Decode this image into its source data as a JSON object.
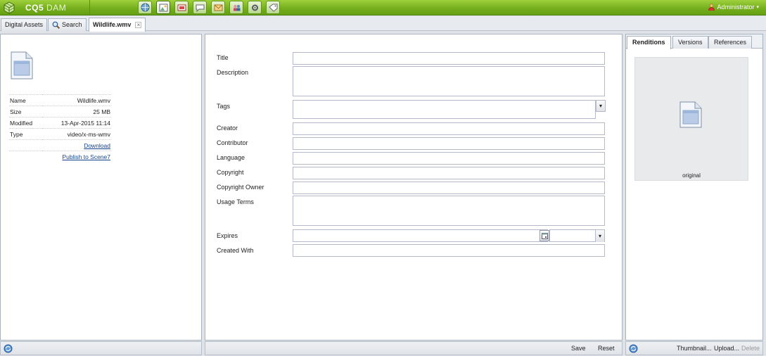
{
  "topbar": {
    "brand": "CQ5",
    "brand_suffix": "DAM",
    "user": "Administrator",
    "icons": [
      "websites-icon",
      "digital-assets-icon",
      "campaigns-icon",
      "community-icon",
      "inbox-icon",
      "users-icon",
      "tools-icon",
      "tagging-icon"
    ]
  },
  "tabs": [
    {
      "label": "Digital Assets"
    },
    {
      "label": "Search"
    },
    {
      "label": "Wildlife.wmv",
      "active": true
    }
  ],
  "file_info": {
    "rows": [
      {
        "label": "Name",
        "value": "Wildlife.wmv"
      },
      {
        "label": "Size",
        "value": "25 MB"
      },
      {
        "label": "Modified",
        "value": "13-Apr-2015 11:14"
      },
      {
        "label": "Type",
        "value": "video/x-ms-wmv"
      }
    ],
    "download": "Download",
    "publish": "Publish to Scene7"
  },
  "form": {
    "title": "Title",
    "description": "Description",
    "tags": "Tags",
    "creator": "Creator",
    "contributor": "Contributor",
    "language": "Language",
    "copyright": "Copyright",
    "copyright_owner": "Copyright Owner",
    "usage_terms": "Usage Terms",
    "expires": "Expires",
    "created_with": "Created With",
    "save": "Save",
    "reset": "Reset"
  },
  "right": {
    "tabs": [
      "Renditions",
      "Versions",
      "References"
    ],
    "rendition_label": "original",
    "thumbnail": "Thumbnail...",
    "upload": "Upload...",
    "delete": "Delete"
  }
}
